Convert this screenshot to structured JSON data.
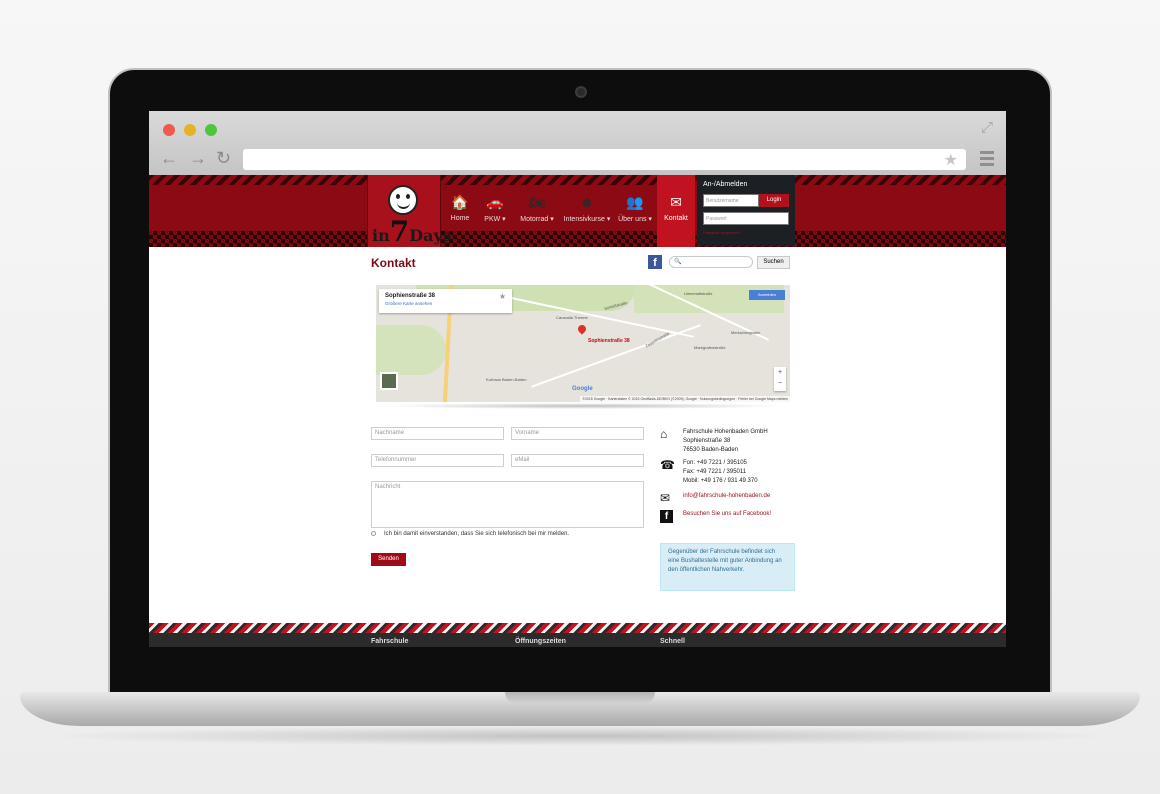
{
  "browser": {
    "back": "←",
    "forward": "→",
    "reload": "↻",
    "bookmark_star": "★",
    "expand": "⤢"
  },
  "site": {
    "logo_text": "in",
    "logo_number": "7",
    "logo_suffix": "Days",
    "nav": [
      {
        "label": "Home",
        "icon": "home-icon",
        "glyph": "🏠"
      },
      {
        "label": "PKW",
        "icon": "car-icon",
        "glyph": "🚗"
      },
      {
        "label": "Motorrad",
        "icon": "motorbike-icon",
        "glyph": "🏍"
      },
      {
        "label": "Intensivkurse",
        "icon": "smiley-icon",
        "glyph": "☻"
      },
      {
        "label": "Über uns",
        "icon": "people-icon",
        "glyph": "👥"
      },
      {
        "label": "Kontakt",
        "icon": "contact-icon",
        "glyph": "✉"
      }
    ],
    "login": {
      "title": "An-/Abmelden",
      "username_placeholder": "Benutzername",
      "password_placeholder": "Passwort",
      "button": "Login",
      "forgot": "Passwort vergessen?"
    }
  },
  "page": {
    "title": "Kontakt",
    "facebook_glyph": "f",
    "search_icon": "🔍",
    "search_button": "Suchen"
  },
  "map": {
    "info_title": "Sophienstraße 38",
    "info_link": "Größere Karte ansehen",
    "sign_in": "Anmelden",
    "pin_label": "Sophienstraße 38",
    "labels": [
      "Caracalla Therme",
      "Kurhaus Baden-Baden",
      "Merkurbergbahn",
      "Markgrafenstraße",
      "Zeppelinstraße",
      "Lilienmattstraße",
      "Schloßstraße"
    ],
    "zoom_in": "+",
    "zoom_out": "−",
    "google": "Google",
    "attribution": "©2015 Google · Kartendaten © 2015 GeoBasis-DE/BKG (©2009), Google · Nutzungsbedingungen · Fehler bei Google Maps melden"
  },
  "form": {
    "lastname_placeholder": "Nachname",
    "firstname_placeholder": "Vorname",
    "phone_placeholder": "Telefonnummer",
    "email_placeholder": "eMail",
    "message_placeholder": "Nachricht",
    "consent": "Ich bin damit einverstanden, dass Sie sich telefonisch bei mir melden.",
    "send": "Senden"
  },
  "contact": {
    "company": "Fahrschule Hohenbaden GmbH",
    "street": "Sophienstraße 38",
    "city": "76530 Baden-Baden",
    "phone": "Fon: +49 7221 / 395105",
    "fax": "Fax: +49 7221 / 395011",
    "mobile": "Mobil: +49 176 / 931 49 370",
    "email": "info@fahrschule-hohenbaden.de",
    "facebook": "Besuchen Sie uns auf Facebook!",
    "note": "Gegenüber der Fahrschule befindet sich eine Bushaltestelle mit guter Anbindung an den öffentlichen Nahverkehr."
  },
  "footer": {
    "col1": "Fahrschule",
    "col2": "Öffnungszeiten",
    "col3": "Schnell"
  }
}
